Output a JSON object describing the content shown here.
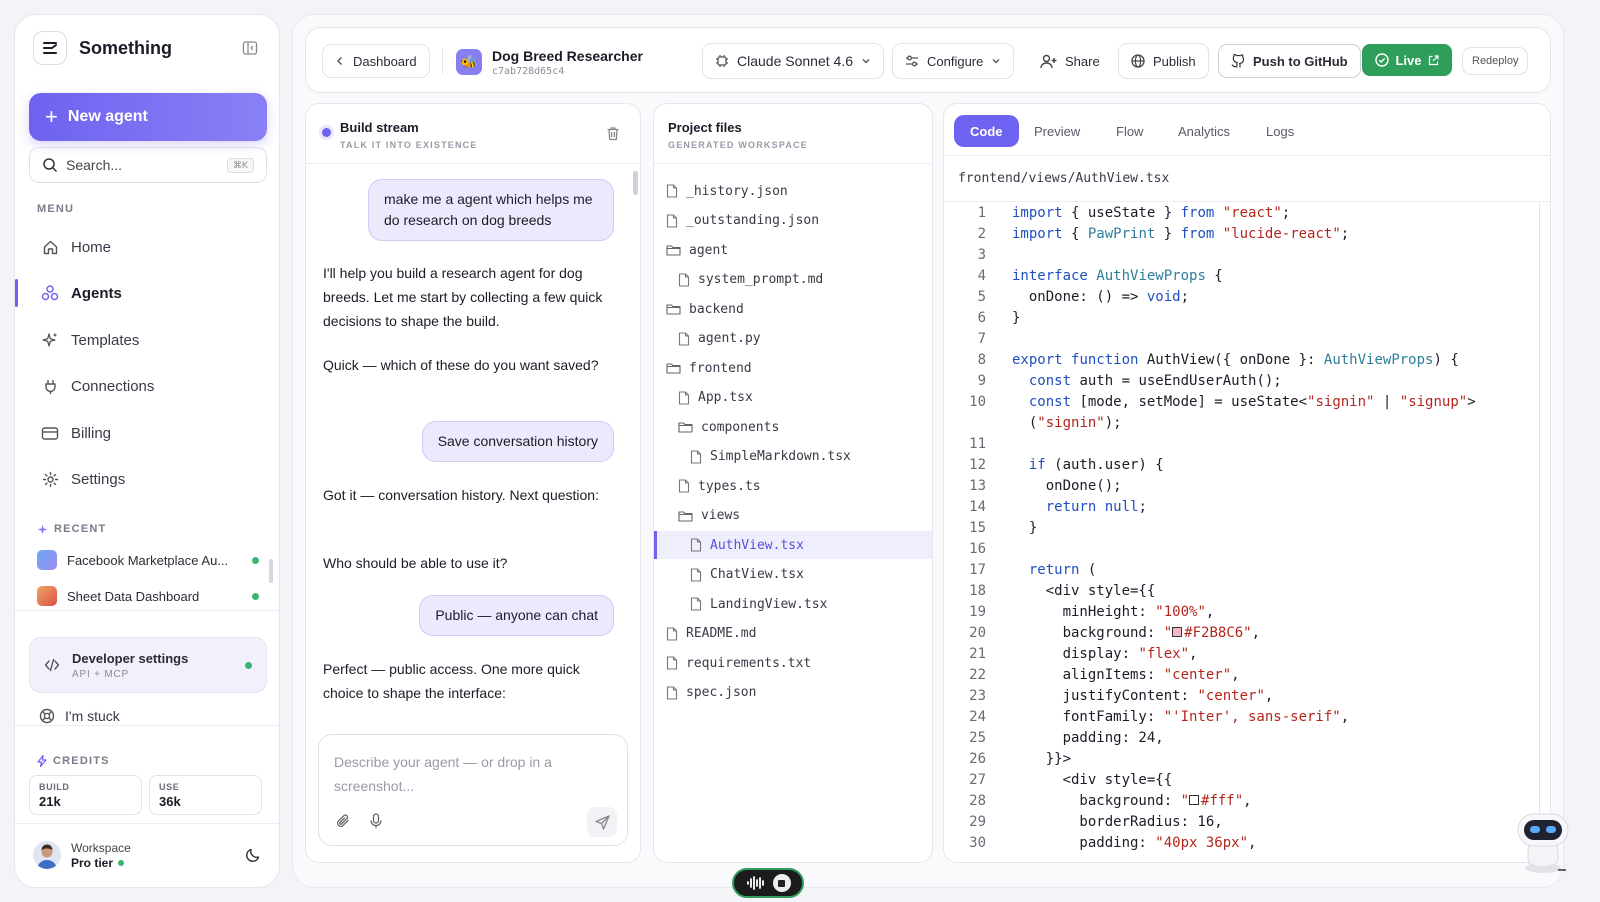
{
  "sidebar": {
    "brand": "Something",
    "new_agent": "New agent",
    "search_placeholder": "Search...",
    "search_shortcut": "⌘K",
    "menu_label": "MENU",
    "menu": [
      {
        "label": "Home",
        "icon": "home-icon"
      },
      {
        "label": "Agents",
        "icon": "agents-icon",
        "active": true
      },
      {
        "label": "Templates",
        "icon": "sparkle-icon"
      },
      {
        "label": "Connections",
        "icon": "plug-icon"
      },
      {
        "label": "Billing",
        "icon": "card-icon"
      },
      {
        "label": "Settings",
        "icon": "gear-icon"
      }
    ],
    "recent_label": "RECENT",
    "recent": [
      {
        "label": "Facebook Marketplace Au..."
      },
      {
        "label": "Sheet Data Dashboard"
      }
    ],
    "dev_settings": {
      "title": "Developer settings",
      "sub": "API + MCP"
    },
    "stuck": "I'm stuck",
    "credits_label": "CREDITS",
    "credits": [
      {
        "label": "BUILD",
        "value": "21k"
      },
      {
        "label": "USE",
        "value": "36k"
      }
    ],
    "workspace": {
      "title": "Workspace",
      "tier": "Pro tier"
    }
  },
  "topbar": {
    "back": "Dashboard",
    "agent_name": "Dog Breed Researcher",
    "agent_hash": "c7ab728d65c4",
    "model": "Claude Sonnet 4.6",
    "configure": "Configure",
    "share": "Share",
    "publish": "Publish",
    "push": "Push to GitHub",
    "live": "Live",
    "redeploy": "Redeploy"
  },
  "build": {
    "title": "Build stream",
    "sub": "TALK IT INTO EXISTENCE",
    "messages": [
      {
        "role": "user",
        "text": "make me a agent which helps me do research on dog breeds"
      },
      {
        "role": "bot",
        "text": "I'll help you build a research agent for dog breeds. Let me start by collecting a few quick decisions to shape the build."
      },
      {
        "role": "bot",
        "text": "Quick — which of these do you want saved?"
      },
      {
        "role": "user",
        "text": "Save conversation history"
      },
      {
        "role": "bot",
        "text": "Got it — conversation history. Next question:"
      },
      {
        "role": "bot",
        "text": "Who should be able to use it?"
      },
      {
        "role": "user",
        "text": "Public — anyone can chat"
      },
      {
        "role": "bot",
        "text": "Perfect — public access. One more quick choice to shape the interface:"
      }
    ],
    "composer_placeholder": "Describe your agent — or drop in a screenshot..."
  },
  "files": {
    "title": "Project files",
    "sub": "GENERATED WORKSPACE",
    "items": [
      {
        "name": "_history.json",
        "type": "file",
        "depth": 0
      },
      {
        "name": "_outstanding.json",
        "type": "file",
        "depth": 0
      },
      {
        "name": "agent",
        "type": "folder",
        "depth": 0
      },
      {
        "name": "system_prompt.md",
        "type": "file",
        "depth": 1
      },
      {
        "name": "backend",
        "type": "folder",
        "depth": 0
      },
      {
        "name": "agent.py",
        "type": "file",
        "depth": 1
      },
      {
        "name": "frontend",
        "type": "folder",
        "depth": 0
      },
      {
        "name": "App.tsx",
        "type": "file",
        "depth": 1
      },
      {
        "name": "components",
        "type": "folder",
        "depth": 1
      },
      {
        "name": "SimpleMarkdown.tsx",
        "type": "file",
        "depth": 2
      },
      {
        "name": "types.ts",
        "type": "file",
        "depth": 1
      },
      {
        "name": "views",
        "type": "folder",
        "depth": 1
      },
      {
        "name": "AuthView.tsx",
        "type": "file",
        "depth": 2,
        "active": true
      },
      {
        "name": "ChatView.tsx",
        "type": "file",
        "depth": 2
      },
      {
        "name": "LandingView.tsx",
        "type": "file",
        "depth": 2
      },
      {
        "name": "README.md",
        "type": "file",
        "depth": 0
      },
      {
        "name": "requirements.txt",
        "type": "file",
        "depth": 0
      },
      {
        "name": "spec.json",
        "type": "file",
        "depth": 0
      }
    ]
  },
  "code": {
    "tabs": [
      "Code",
      "Preview",
      "Flow",
      "Analytics",
      "Logs"
    ],
    "active_tab": "Code",
    "path": "frontend/views/AuthView.tsx",
    "lines": [
      {
        "n": "1",
        "t": "import { useState } from \"react\";"
      },
      {
        "n": "2",
        "t": "import { PawPrint } from \"lucide-react\";"
      },
      {
        "n": "3",
        "t": ""
      },
      {
        "n": "4",
        "t": "interface AuthViewProps {"
      },
      {
        "n": "5",
        "t": "  onDone: () => void;"
      },
      {
        "n": "6",
        "t": "}"
      },
      {
        "n": "7",
        "t": ""
      },
      {
        "n": "8",
        "t": "export function AuthView({ onDone }: AuthViewProps) {"
      },
      {
        "n": "9",
        "t": "  const auth = useEndUserAuth();"
      },
      {
        "n": "10",
        "t": "  const [mode, setMode] = useState<\"signin\" | \"signup\">"
      },
      {
        "n": "",
        "t": "  (\"signin\");"
      },
      {
        "n": "11",
        "t": ""
      },
      {
        "n": "12",
        "t": "  if (auth.user) {"
      },
      {
        "n": "13",
        "t": "    onDone();"
      },
      {
        "n": "14",
        "t": "    return null;"
      },
      {
        "n": "15",
        "t": "  }"
      },
      {
        "n": "16",
        "t": ""
      },
      {
        "n": "17",
        "t": "  return ("
      },
      {
        "n": "18",
        "t": "    <div style={{"
      },
      {
        "n": "19",
        "t": "      minHeight: \"100%\","
      },
      {
        "n": "20",
        "t": "      background: \"#F2B8C6\","
      },
      {
        "n": "21",
        "t": "      display: \"flex\","
      },
      {
        "n": "22",
        "t": "      alignItems: \"center\","
      },
      {
        "n": "23",
        "t": "      justifyContent: \"center\","
      },
      {
        "n": "24",
        "t": "      fontFamily: \"'Inter', sans-serif\","
      },
      {
        "n": "25",
        "t": "      padding: 24,"
      },
      {
        "n": "26",
        "t": "    }}>"
      },
      {
        "n": "27",
        "t": "      <div style={{"
      },
      {
        "n": "28",
        "t": "        background: \"#fff\","
      },
      {
        "n": "29",
        "t": "        borderRadius: 16,"
      },
      {
        "n": "30",
        "t": "        padding: \"40px 36px\","
      }
    ]
  },
  "colors": {
    "accent": "#6e62f0",
    "live": "#2f9e5a",
    "swatch_pink": "#F2B8C6"
  }
}
